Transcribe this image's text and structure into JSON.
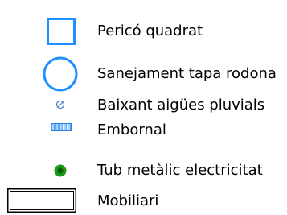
{
  "legend": {
    "items": [
      {
        "label": "Pericó quadrat",
        "symbol": "blue-square-outline-icon",
        "color": "#1e90ff"
      },
      {
        "label": "Sanejament tapa rodona",
        "symbol": "blue-circle-outline-icon",
        "color": "#1e90ff"
      },
      {
        "label": "Baixant aigües pluvials",
        "symbol": "small-slashed-circle-icon",
        "color": "#1e90ff"
      },
      {
        "label": "Embornal",
        "symbol": "grate-icon",
        "color": "#1e90ff"
      },
      {
        "label": "Tub metàlic electricitat",
        "symbol": "green-dot-icon",
        "color": "#1a9a1a"
      },
      {
        "label": "Mobiliari",
        "symbol": "rectangle-outline-icon",
        "color": "#000000"
      }
    ]
  }
}
